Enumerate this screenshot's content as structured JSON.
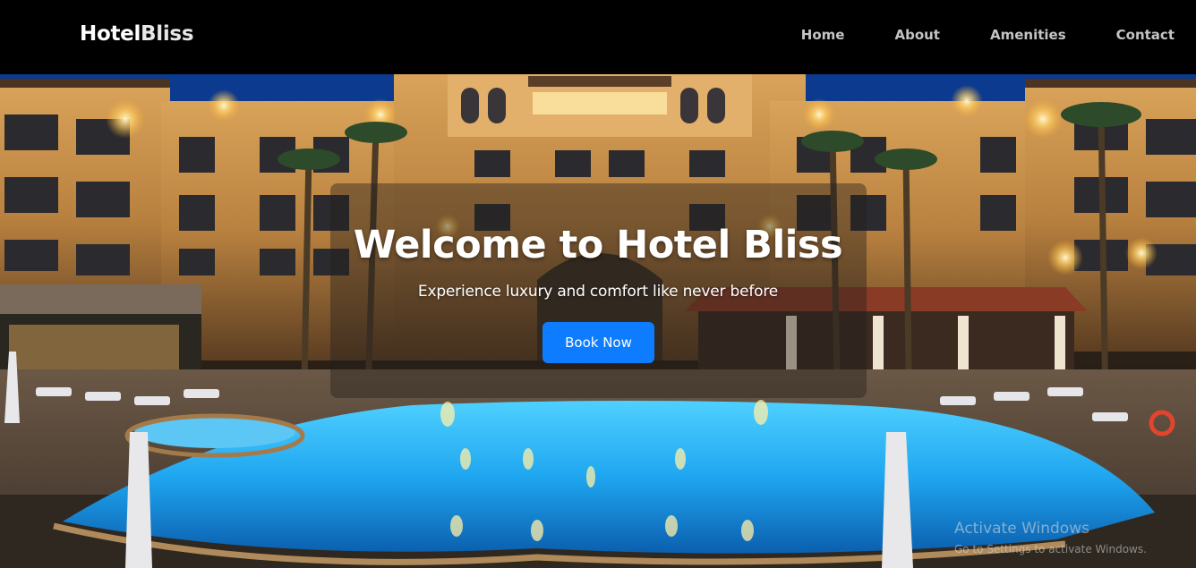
{
  "navbar": {
    "brand_part1": "Hotel",
    "brand_part2": "Bliss",
    "links": [
      "Home",
      "About",
      "Amenities",
      "Contact"
    ]
  },
  "hero": {
    "title": "Welcome to Hotel Bliss",
    "subtitle": "Experience luxury and comfort like never before",
    "button_label": "Book Now"
  },
  "watermark": {
    "title": "Activate Windows",
    "subtitle": "Go to Settings to activate Windows."
  },
  "colors": {
    "navbar_bg": "#000000",
    "button_bg": "#0d7cff",
    "nav_link": "#c4c4c4",
    "pool": "#1fa6f0"
  }
}
